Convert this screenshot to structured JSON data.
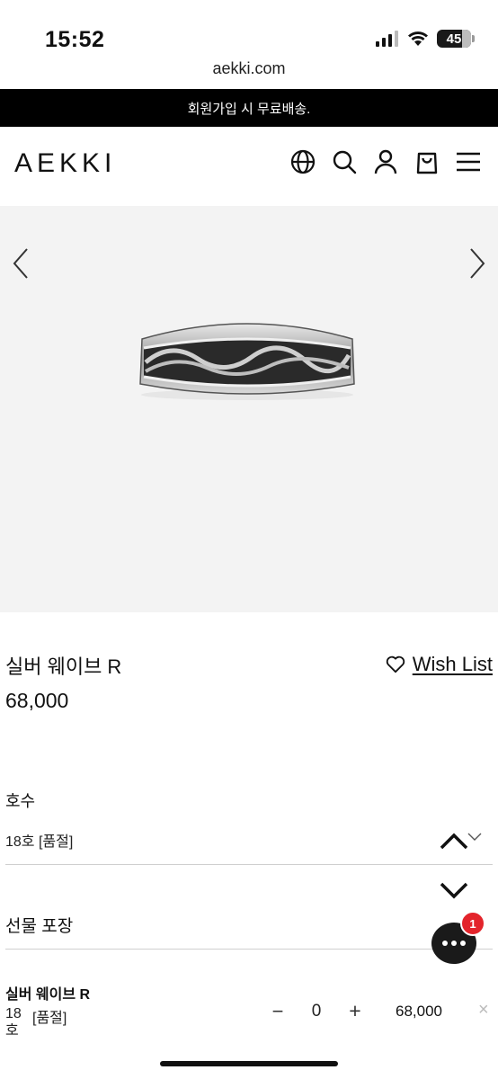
{
  "status_bar": {
    "time": "15:52",
    "battery": "45",
    "icons": [
      "cellular-signal-icon",
      "wifi-icon",
      "battery-icon"
    ]
  },
  "browser": {
    "url": "aekki.com"
  },
  "promo_banner": {
    "text": "회원가입 시 무료배송."
  },
  "header": {
    "logo": "AEKKI",
    "icons": [
      "globe-icon",
      "search-icon",
      "user-icon",
      "cart-icon",
      "menu-icon"
    ]
  },
  "gallery": {
    "prev_icon": "chevron-left-icon",
    "next_icon": "chevron-right-icon",
    "background": "#f3f3f3"
  },
  "product": {
    "title": "실버 웨이브 R",
    "price": "68,000",
    "wishlist_label": "Wish List"
  },
  "options": {
    "size_label": "호수",
    "size_value": "18호 [품절]",
    "gift_label": "선물 포장"
  },
  "chat": {
    "badge_count": "1",
    "icon": "chat-bubble-icon",
    "badge_color": "#e3242b"
  },
  "selected_item": {
    "name": "실버 웨이브 R",
    "size": "18 호",
    "status": "[품절]",
    "quantity": "0",
    "minus": "−",
    "plus": "+",
    "price": "68,000",
    "remove": "×"
  },
  "colors": {
    "banner_bg": "#000000",
    "text": "#111111"
  }
}
